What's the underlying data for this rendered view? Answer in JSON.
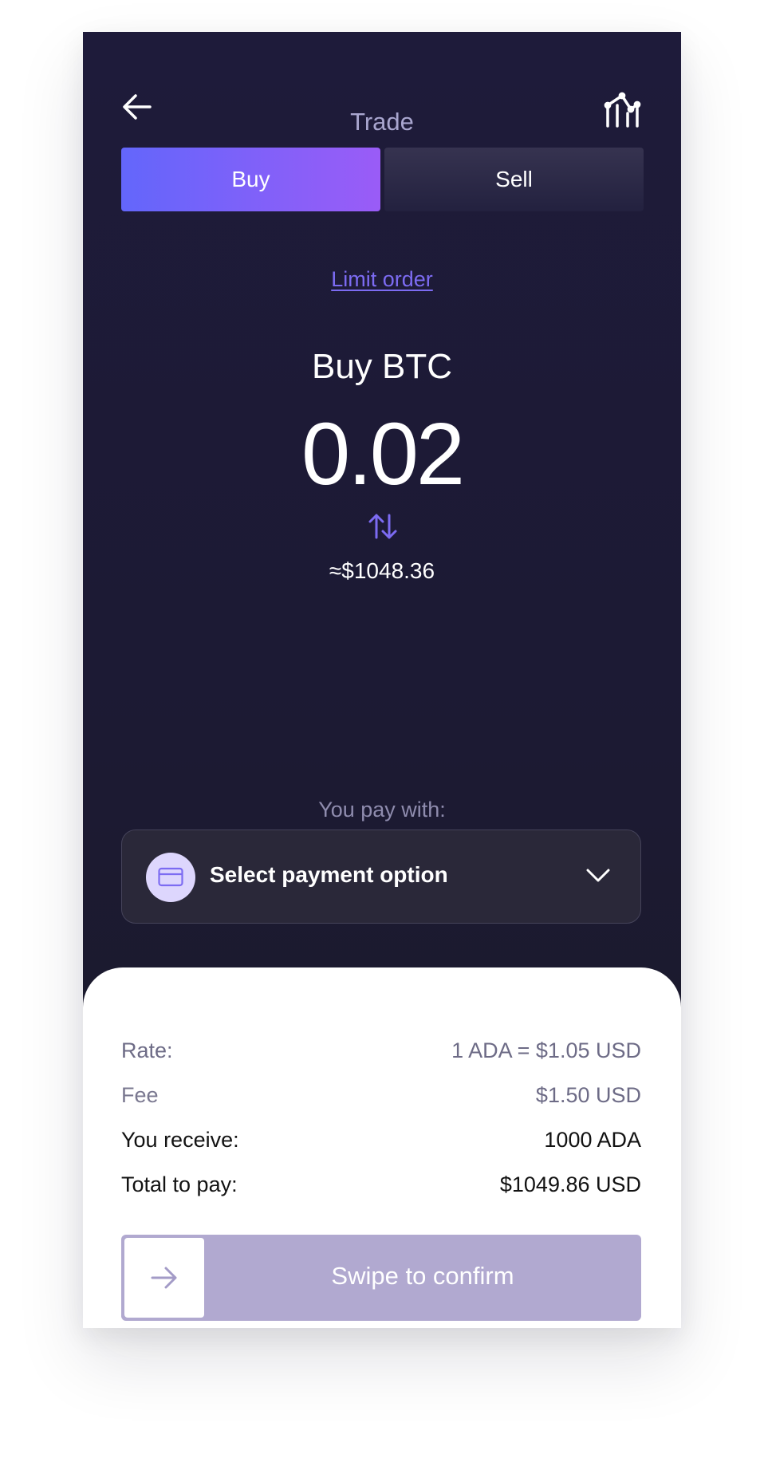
{
  "header": {
    "title": "Trade",
    "back_icon": "arrow-left-icon",
    "chart_icon": "chart-line-icon"
  },
  "tabs": [
    {
      "label": "Buy",
      "active": true
    },
    {
      "label": "Sell",
      "active": false
    }
  ],
  "limit_order": {
    "label": "Limit order"
  },
  "order": {
    "heading": "Buy BTC",
    "amount": "0.02",
    "swap_icon": "swap-arrows-icon",
    "approx_value": "≈$1048.36"
  },
  "payment": {
    "label": "You pay with:",
    "select_text": "Select payment option",
    "card_icon": "credit-card-icon",
    "chevron_icon": "chevron-down-icon"
  },
  "summary": {
    "rate": {
      "label": "Rate:",
      "value": "1 ADA = $1.05 USD"
    },
    "fee": {
      "label": "Fee",
      "value": "$1.50 USD"
    },
    "receive": {
      "label": "You receive:",
      "value": "1000 ADA"
    },
    "total": {
      "label": "Total to pay:",
      "value": "$1049.86 USD"
    }
  },
  "confirm": {
    "label": "Swipe to confirm",
    "handle_icon": "arrow-right-icon"
  },
  "colors": {
    "accent_start": "#6366fb",
    "accent_end": "#9a5cf7",
    "link": "#7c6bf2",
    "background": "#1e1b3a",
    "swipe_track": "#b1a9d0"
  }
}
